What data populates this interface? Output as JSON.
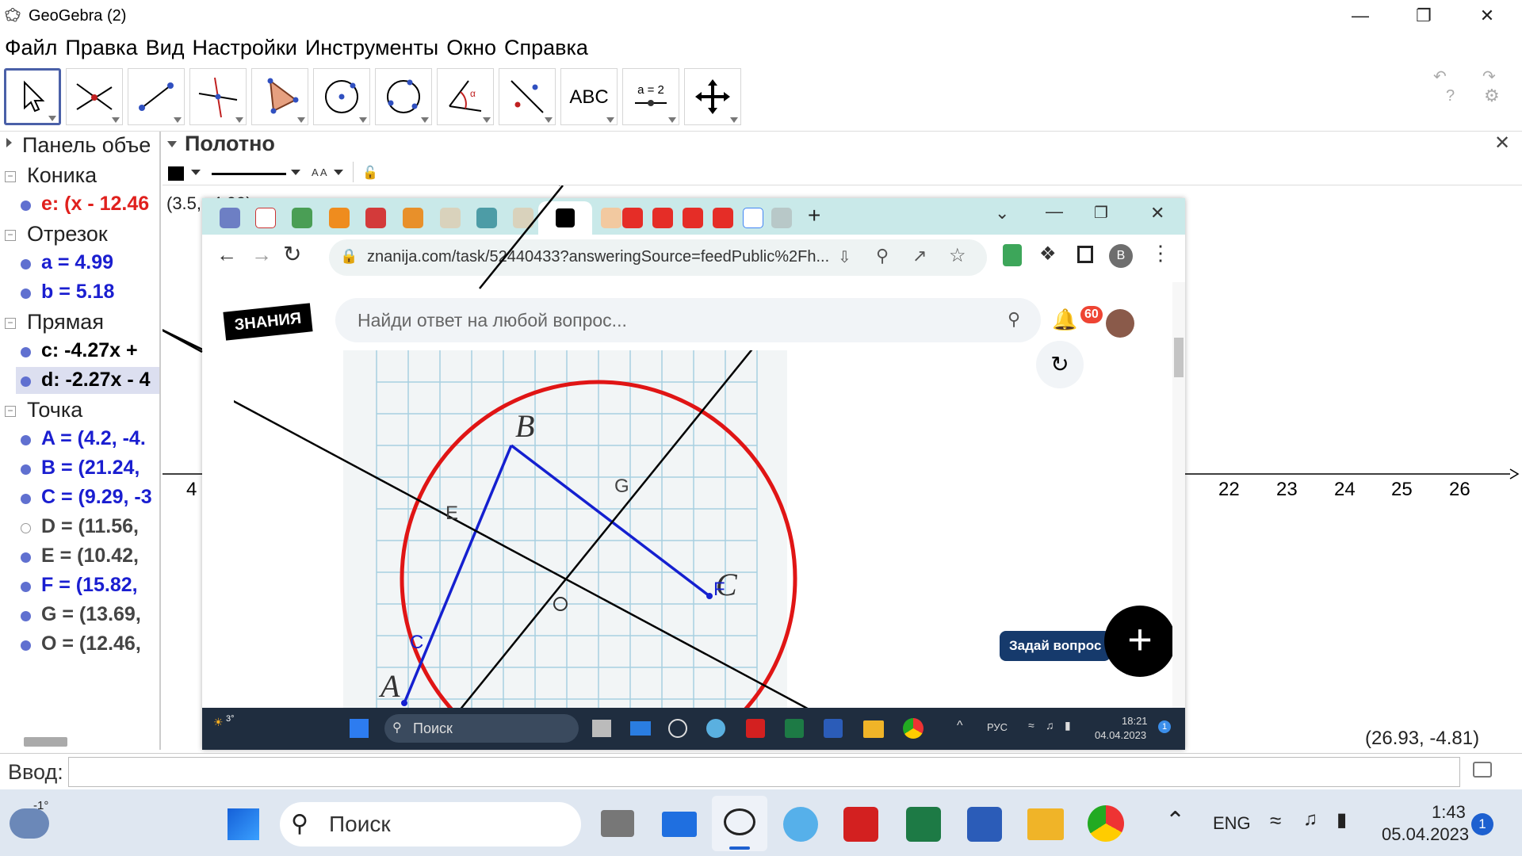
{
  "window": {
    "title": "GeoGebra (2)"
  },
  "menu": [
    "Файл",
    "Правка",
    "Вид",
    "Настройки",
    "Инструменты",
    "Окно",
    "Справка"
  ],
  "algebra": {
    "header": "Панель объе",
    "categories": [
      {
        "label": "Коника",
        "items": [
          {
            "text": "e: (x - 12.46",
            "color": "#e0201d",
            "dot": "#5b6bd3"
          }
        ]
      },
      {
        "label": "Отрезок",
        "items": [
          {
            "text": "a = 4.99",
            "color": "#1a1ed0",
            "dot": "#5b6bd3"
          },
          {
            "text": "b = 5.18",
            "color": "#1a1ed0",
            "dot": "#5b6bd3"
          }
        ]
      },
      {
        "label": "Прямая",
        "items": [
          {
            "text": "c: -4.27x +",
            "color": "#000000",
            "dot": "#5b6bd3"
          },
          {
            "text": "d: -2.27x - 4",
            "color": "#000000",
            "dot": "#5b6bd3",
            "selected": true
          }
        ]
      },
      {
        "label": "Точка",
        "items": [
          {
            "text": "A = (4.2, -4.",
            "color": "#1a1ed0",
            "dot": "#5b6bd3"
          },
          {
            "text": "B = (21.24,",
            "color": "#1a1ed0",
            "dot": "#5b6bd3"
          },
          {
            "text": "C = (9.29, -3",
            "color": "#1a1ed0",
            "dot": "#5b6bd3"
          },
          {
            "text": "D = (11.56,",
            "color": "#444444",
            "dot": "none"
          },
          {
            "text": "E = (10.42,",
            "color": "#444444",
            "dot": "#5b6bd3"
          },
          {
            "text": "F = (15.82,",
            "color": "#1a1ed0",
            "dot": "#5b6bd3"
          },
          {
            "text": "G = (13.69,",
            "color": "#444444",
            "dot": "#5b6bd3"
          },
          {
            "text": "O = (12.46,",
            "color": "#444444",
            "dot": "#5b6bd3"
          }
        ]
      }
    ]
  },
  "graphics": {
    "header": "Полотно",
    "coord_top": "(3.5, -4.09)",
    "coord_bottom": "(26.93, -4.81)",
    "x_ticks": [
      "4",
      "22",
      "23",
      "24",
      "25",
      "26"
    ]
  },
  "input": {
    "label": "Ввод:"
  },
  "browser": {
    "url": "znanija.com/task/52440433?answeringSource=feedPublic%2Fh...",
    "search_placeholder": "Найди ответ на любой вопрос...",
    "logo": "ЗНАНИЯ",
    "notif_count": "60",
    "avatar_letter": "B",
    "ask_button": "Задай вопрос",
    "figure_labels": {
      "B": "B",
      "A": "A",
      "C": "C",
      "E": "E",
      "G": "G",
      "F": "F",
      "O": "O",
      "C2": "C"
    },
    "inner_taskbar": {
      "weather": "3°",
      "search": "Поиск",
      "lang": "РУС",
      "time": "18:21",
      "date": "04.04.2023",
      "notif": "1"
    }
  },
  "taskbar": {
    "weather": "-1°",
    "search": "Поиск",
    "lang": "ENG",
    "time": "1:43",
    "date": "05.04.2023",
    "notif": "1"
  }
}
